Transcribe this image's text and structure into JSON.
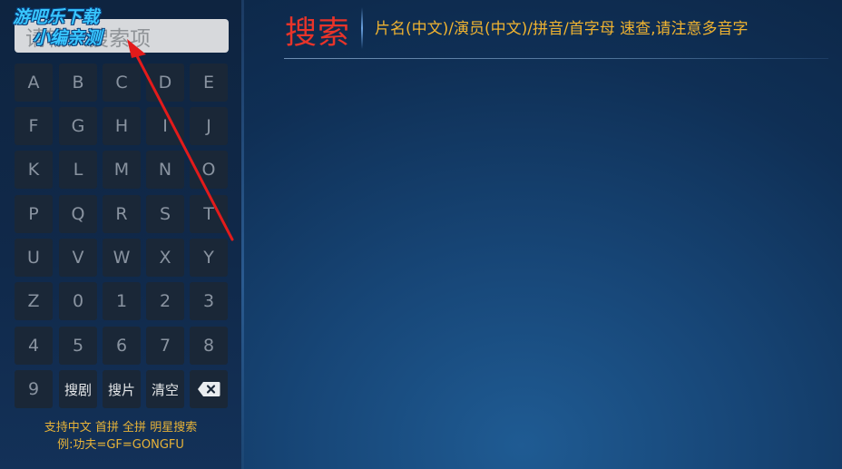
{
  "search": {
    "placeholder": "请输入搜索项",
    "watermark_line1": "游吧乐下载",
    "watermark_line2": "小编亲测"
  },
  "keyboard": {
    "keys": [
      "A",
      "B",
      "C",
      "D",
      "E",
      "F",
      "G",
      "H",
      "I",
      "J",
      "K",
      "L",
      "M",
      "N",
      "O",
      "P",
      "Q",
      "R",
      "S",
      "T",
      "U",
      "V",
      "W",
      "X",
      "Y",
      "Z",
      "0",
      "1",
      "2",
      "3",
      "4",
      "5",
      "6",
      "7",
      "8",
      "9",
      "搜剧",
      "搜片",
      "清空"
    ],
    "backspace_icon": "backspace-icon"
  },
  "hints": {
    "line1": "支持中文 首拼 全拼 明星搜索",
    "line2": "例:功夫=GF=GONGFU"
  },
  "header": {
    "title": "搜索",
    "hint": "片名(中文)/演员(中文)/拼音/首字母 速查,请注意多音字"
  },
  "colors": {
    "title": "#e8342a",
    "hint": "#f0b330",
    "key_bg": "#1a2737",
    "annotation_arrow": "#e31b1b",
    "watermark": "#38c6ff"
  }
}
